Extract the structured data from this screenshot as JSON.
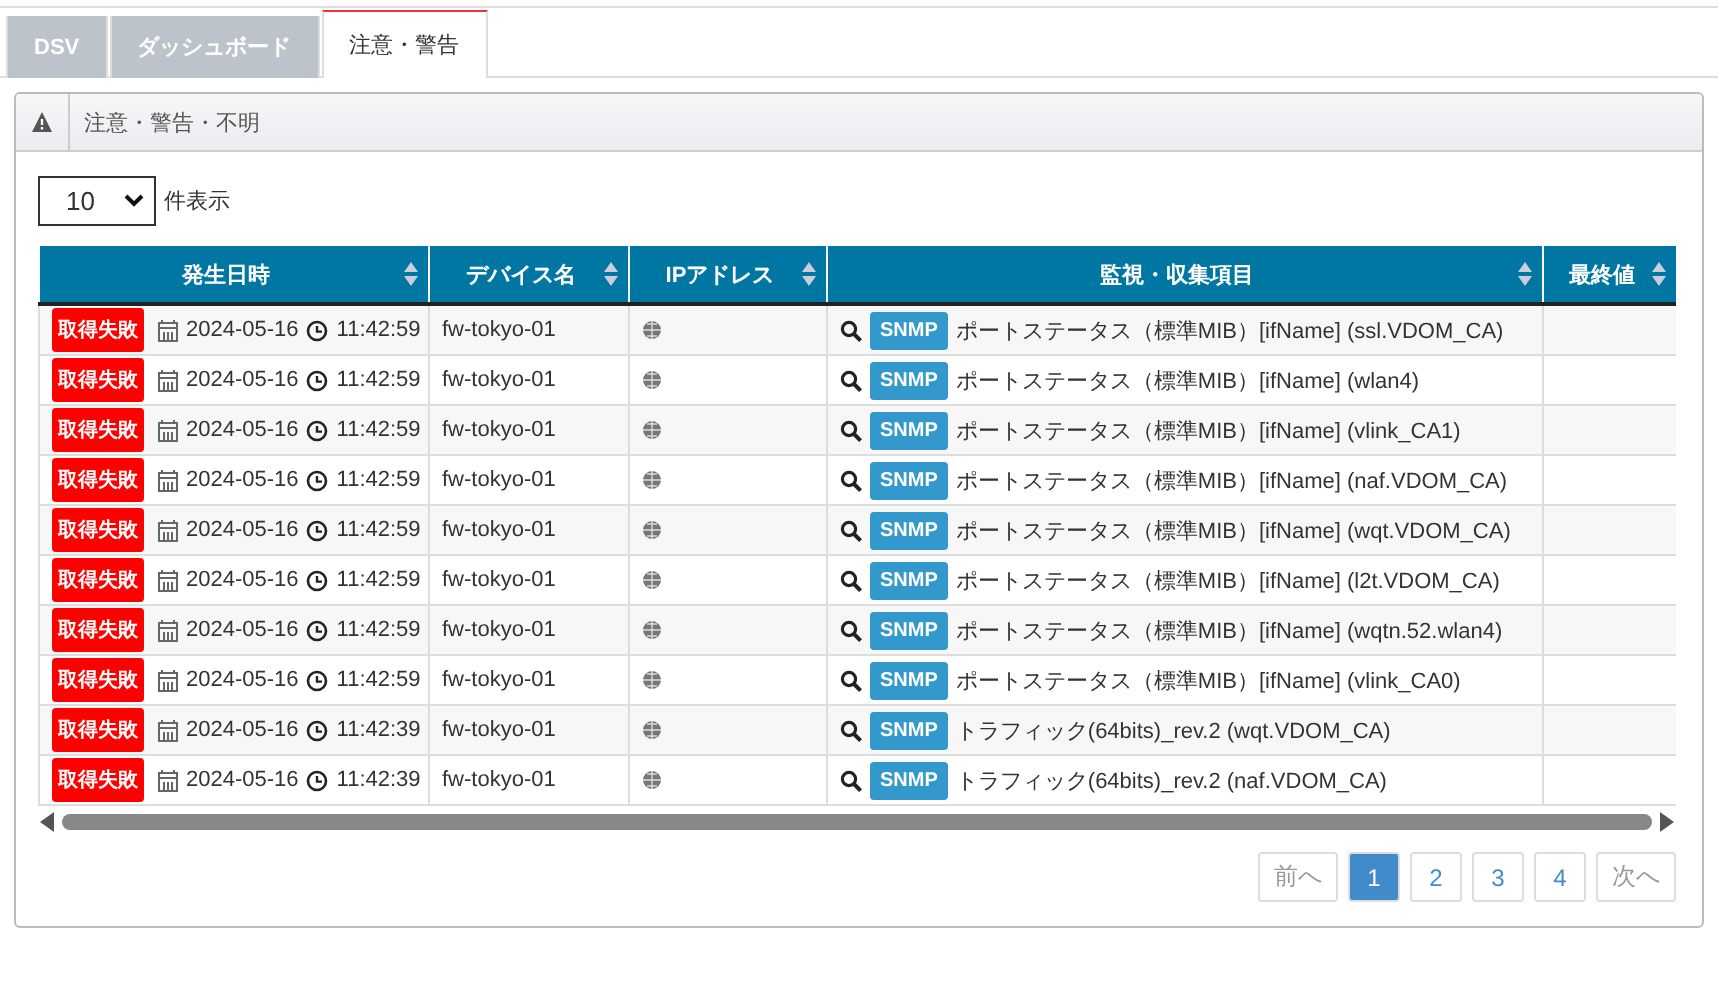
{
  "tabs": [
    {
      "label": "DSV",
      "selected": false
    },
    {
      "label": "ダッシュボード",
      "selected": false
    },
    {
      "label": "注意・警告",
      "selected": true
    }
  ],
  "panel": {
    "title": "注意・警告・不明"
  },
  "page_size": {
    "value": "10",
    "label": "件表示"
  },
  "table": {
    "columns": [
      {
        "label": "発生日時",
        "sortable": true
      },
      {
        "label": "デバイス名",
        "sortable": true
      },
      {
        "label": "IPアドレス",
        "sortable": true
      },
      {
        "label": "監視・収集項目",
        "sortable": true
      },
      {
        "label": "最終値",
        "sortable": true
      }
    ],
    "rows": [
      {
        "status": "取得失敗",
        "date": "2024-05-16",
        "time": "11:42:59",
        "device": "fw-tokyo-01",
        "protocol": "SNMP",
        "item": "ポートステータス（標準MIB）[ifName] (ssl.VDOM_CA)"
      },
      {
        "status": "取得失敗",
        "date": "2024-05-16",
        "time": "11:42:59",
        "device": "fw-tokyo-01",
        "protocol": "SNMP",
        "item": "ポートステータス（標準MIB）[ifName] (wlan4)"
      },
      {
        "status": "取得失敗",
        "date": "2024-05-16",
        "time": "11:42:59",
        "device": "fw-tokyo-01",
        "protocol": "SNMP",
        "item": "ポートステータス（標準MIB）[ifName] (vlink_CA1)"
      },
      {
        "status": "取得失敗",
        "date": "2024-05-16",
        "time": "11:42:59",
        "device": "fw-tokyo-01",
        "protocol": "SNMP",
        "item": "ポートステータス（標準MIB）[ifName] (naf.VDOM_CA)"
      },
      {
        "status": "取得失敗",
        "date": "2024-05-16",
        "time": "11:42:59",
        "device": "fw-tokyo-01",
        "protocol": "SNMP",
        "item": "ポートステータス（標準MIB）[ifName] (wqt.VDOM_CA)"
      },
      {
        "status": "取得失敗",
        "date": "2024-05-16",
        "time": "11:42:59",
        "device": "fw-tokyo-01",
        "protocol": "SNMP",
        "item": "ポートステータス（標準MIB）[ifName] (l2t.VDOM_CA)"
      },
      {
        "status": "取得失敗",
        "date": "2024-05-16",
        "time": "11:42:59",
        "device": "fw-tokyo-01",
        "protocol": "SNMP",
        "item": "ポートステータス（標準MIB）[ifName] (wqtn.52.wlan4)"
      },
      {
        "status": "取得失敗",
        "date": "2024-05-16",
        "time": "11:42:59",
        "device": "fw-tokyo-01",
        "protocol": "SNMP",
        "item": "ポートステータス（標準MIB）[ifName] (vlink_CA0)"
      },
      {
        "status": "取得失敗",
        "date": "2024-05-16",
        "time": "11:42:39",
        "device": "fw-tokyo-01",
        "protocol": "SNMP",
        "item": "トラフィック(64bits)_rev.2 (wqt.VDOM_CA)"
      },
      {
        "status": "取得失敗",
        "date": "2024-05-16",
        "time": "11:42:39",
        "device": "fw-tokyo-01",
        "protocol": "SNMP",
        "item": "トラフィック(64bits)_rev.2 (naf.VDOM_CA)"
      }
    ]
  },
  "pagination": [
    {
      "label": "前へ",
      "kind": "nav",
      "selected": false
    },
    {
      "label": "1",
      "kind": "page",
      "selected": true
    },
    {
      "label": "2",
      "kind": "page",
      "selected": false
    },
    {
      "label": "3",
      "kind": "page",
      "selected": false
    },
    {
      "label": "4",
      "kind": "page",
      "selected": false
    },
    {
      "label": "次へ",
      "kind": "nav",
      "selected": false
    }
  ]
}
